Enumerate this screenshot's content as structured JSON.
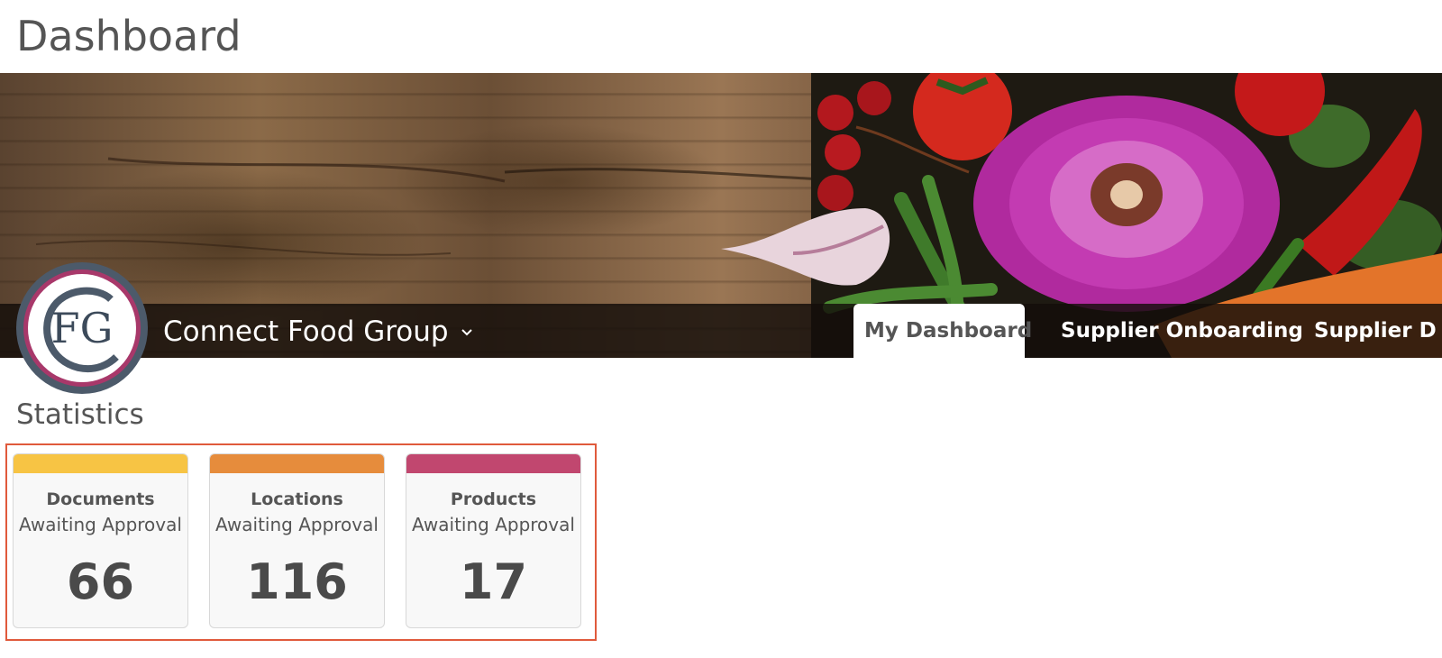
{
  "page": {
    "title": "Dashboard"
  },
  "banner": {
    "organization": "Connect Food Group",
    "logo_text": "FG"
  },
  "tabs": [
    {
      "label": "My Dashboard",
      "active": true
    },
    {
      "label": "Supplier Onboarding",
      "active": false
    },
    {
      "label": "Supplier D",
      "active": false
    }
  ],
  "statistics": {
    "title": "Statistics",
    "cards": [
      {
        "name": "Documents",
        "subtitle": "Awaiting Approval",
        "value": "66",
        "color": "#f7c444"
      },
      {
        "name": "Locations",
        "subtitle": "Awaiting Approval",
        "value": "116",
        "color": "#e68c3c"
      },
      {
        "name": "Products",
        "subtitle": "Awaiting Approval",
        "value": "17",
        "color": "#c1476f"
      }
    ]
  },
  "colors": {
    "highlight_frame": "#e05a3c",
    "logo_ring_outer": "#4c5a6a",
    "logo_ring_inner": "#a8386a"
  }
}
